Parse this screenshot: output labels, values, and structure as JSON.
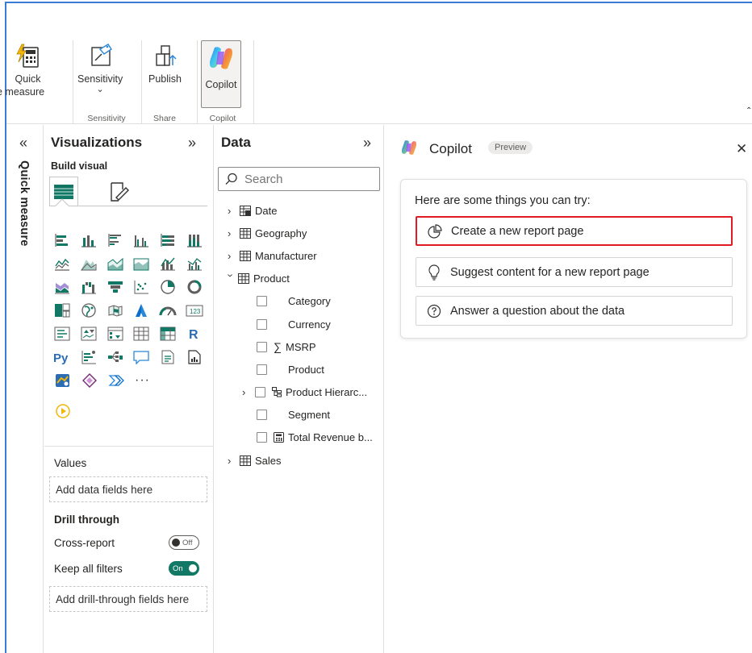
{
  "ribbon": {
    "quick_measure": {
      "line1": "Quick",
      "line2": "e measure"
    },
    "sensitivity": {
      "label": "Sensitivity",
      "chevron": "⌄"
    },
    "publish": {
      "label": "Publish"
    },
    "copilot": {
      "label": "Copilot"
    },
    "groups": {
      "sensitivity": "Sensitivity",
      "share": "Share",
      "copilot": "Copilot"
    },
    "overflow_chevron": "⌃"
  },
  "rail": {
    "collapse_icon": "«",
    "label": "Quick measure"
  },
  "visualizations": {
    "title": "Visualizations",
    "expand_icon": "»",
    "build_visual": "Build visual",
    "more": "···",
    "values_label": "Values",
    "values_placeholder": "Add data fields here",
    "drill_through": "Drill through",
    "cross_report": {
      "label": "Cross-report",
      "state": "Off"
    },
    "keep_all_filters": {
      "label": "Keep all filters",
      "state": "On"
    },
    "drill_placeholder": "Add drill-through fields here"
  },
  "data_pane": {
    "title": "Data",
    "expand_icon": "»",
    "search_placeholder": "Search",
    "tables": [
      "Date",
      "Geography",
      "Manufacturer",
      "Product"
    ],
    "product_fields": [
      "Category",
      "Currency",
      "MSRP",
      "Product",
      "Product Hierarc...",
      "Segment",
      "Total Revenue b..."
    ],
    "sales": "Sales"
  },
  "copilot": {
    "title": "Copilot",
    "badge": "Preview",
    "close": "✕",
    "hint": "Here are some things you can try:",
    "options": [
      {
        "label": "Create a new report page",
        "icon": "pie-chart-icon"
      },
      {
        "label": "Suggest content for a new report page",
        "icon": "lightbulb-icon"
      },
      {
        "label": "Answer a question about the data",
        "icon": "question-icon"
      }
    ],
    "highlight_color": "#e01b24"
  },
  "colors": {
    "accent": "#117865",
    "frame": "#3a7bd5"
  }
}
